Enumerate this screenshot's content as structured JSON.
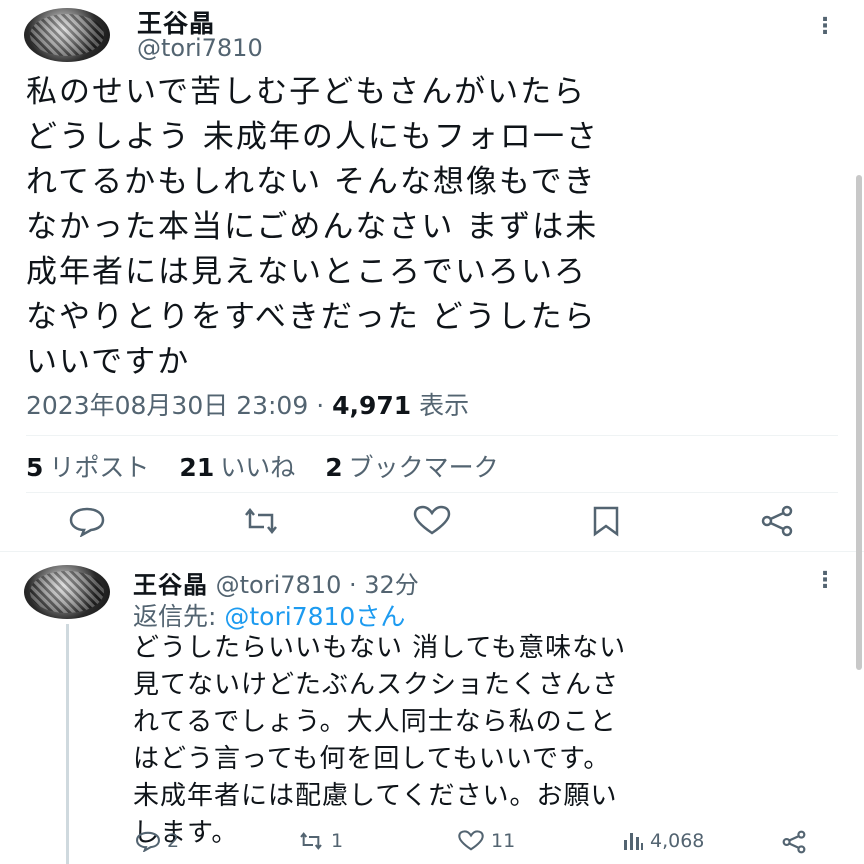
{
  "main_tweet": {
    "author_name": "王谷晶",
    "author_handle": "@tori7810",
    "text_lines": [
      "私のせいで苦しむ子どもさんがいたら",
      "どうしよう 未成年の人にもフォロ一さ",
      "れてるかもしれない そんな想像もでき",
      "なかった本当にごめんなさい まずは未",
      "成年者には見えないところでいろいろ",
      "なやりとりをすべきだった どうしたら",
      "いいですか"
    ],
    "timestamp": "2023年08月30日 23:09",
    "separator": "·",
    "views_count": "4,971",
    "views_label": "表示",
    "stats": {
      "reposts_count": "5",
      "reposts_label": "リポスト",
      "likes_count": "21",
      "likes_label": "いいね",
      "bookmarks_count": "2",
      "bookmarks_label": "ブックマーク"
    },
    "actions": [
      "reply-icon",
      "repost-icon",
      "like-icon",
      "bookmark-icon",
      "share-icon"
    ]
  },
  "reply_tweet": {
    "author_name": "王谷晶",
    "author_handle_time": "@tori7810 · 32分",
    "reply_to_prefix": "返信先: ",
    "reply_to_handle": "@tori7810さん",
    "text_lines": [
      "どうしたらいいもない 消しても意味ない",
      "見てないけどたぶんスクショたくさんさ",
      "れてるでしょう。大人同士なら私のこと",
      "はどう言っても何を回してもいいです。",
      "未成年者には配慮してください。お願い",
      "します。"
    ],
    "actions": {
      "replies": "2",
      "reposts": "1",
      "likes": "11",
      "views": "4,068"
    }
  }
}
